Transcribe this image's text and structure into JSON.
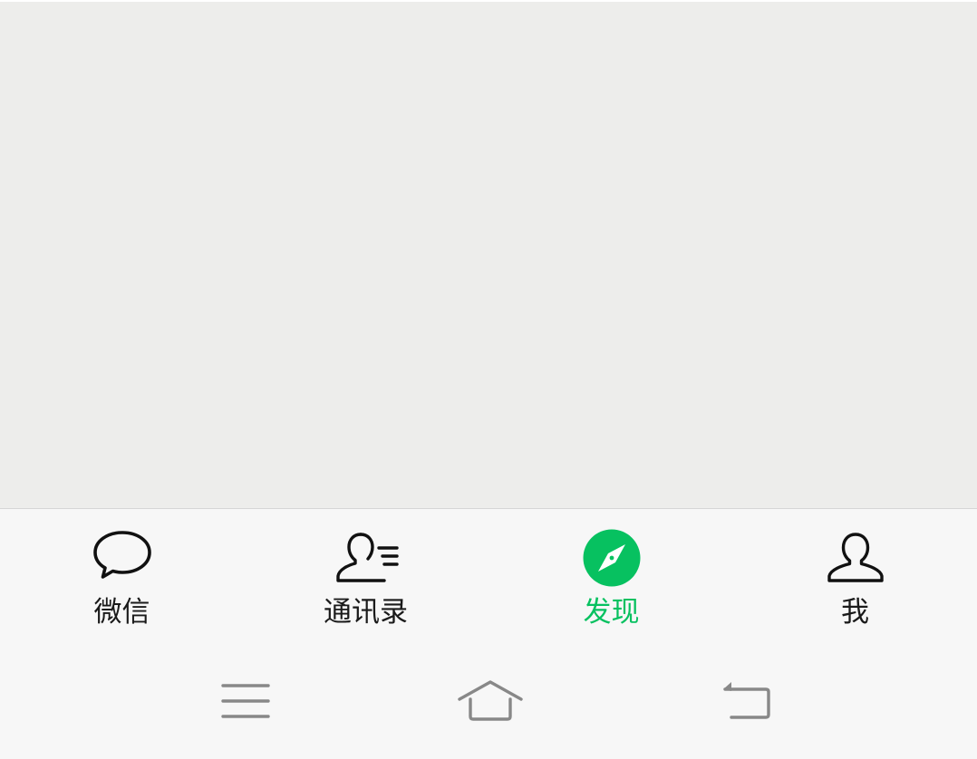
{
  "colors": {
    "content_bg": "#ededeb",
    "bar_bg": "#f7f7f7",
    "active": "#07c160",
    "inactive_text": "#1a1a1a",
    "nav_icon": "#888888"
  },
  "tabbar": {
    "tabs": [
      {
        "label": "微信",
        "icon": "chat-bubble-icon",
        "active": false
      },
      {
        "label": "通讯录",
        "icon": "contacts-icon",
        "active": false
      },
      {
        "label": "发现",
        "icon": "compass-icon",
        "active": true
      },
      {
        "label": "我",
        "icon": "person-icon",
        "active": false
      }
    ]
  },
  "system_nav": {
    "buttons": [
      {
        "icon": "menu-icon"
      },
      {
        "icon": "home-icon"
      },
      {
        "icon": "back-icon"
      }
    ]
  }
}
